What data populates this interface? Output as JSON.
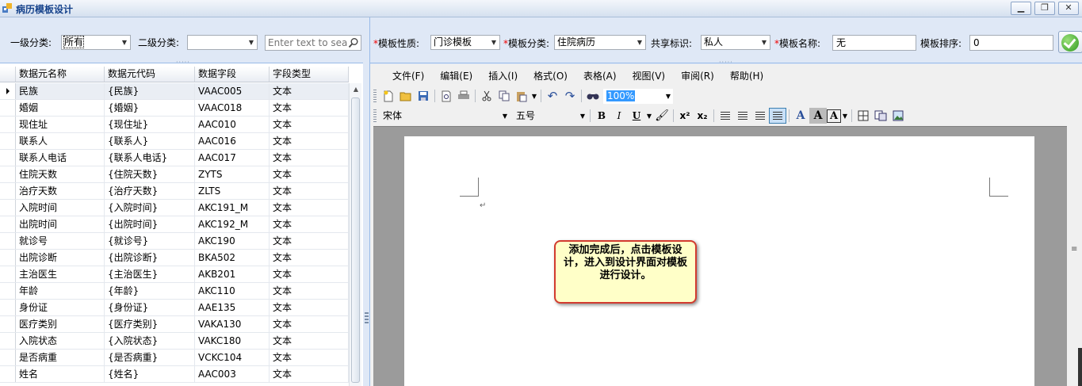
{
  "window": {
    "title": "病历模板设计",
    "min": "▁",
    "restore": "❐",
    "close": "✕"
  },
  "filters": {
    "level1_label": "一级分类:",
    "level1_value": "所有",
    "level2_label": "二级分类:",
    "level2_value": "",
    "search_placeholder": "Enter text to sear"
  },
  "grid": {
    "columns": [
      "数据元名称",
      "数据元代码",
      "数据字段",
      "字段类型"
    ],
    "rows": [
      [
        "民族",
        "{民族}",
        "VAAC005",
        "文本"
      ],
      [
        "婚姻",
        "{婚姻}",
        "VAAC018",
        "文本"
      ],
      [
        "现住址",
        "{现住址}",
        "AAC010",
        "文本"
      ],
      [
        "联系人",
        "{联系人}",
        "AAC016",
        "文本"
      ],
      [
        "联系人电话",
        "{联系人电话}",
        "AAC017",
        "文本"
      ],
      [
        "住院天数",
        "{住院天数}",
        "ZYTS",
        "文本"
      ],
      [
        "治疗天数",
        "{治疗天数}",
        "ZLTS",
        "文本"
      ],
      [
        "入院时间",
        "{入院时间}",
        "AKC191_M",
        "文本"
      ],
      [
        "出院时间",
        "{出院时间}",
        "AKC192_M",
        "文本"
      ],
      [
        "就诊号",
        "{就诊号}",
        "AKC190",
        "文本"
      ],
      [
        "出院诊断",
        "{出院诊断}",
        "BKA502",
        "文本"
      ],
      [
        "主治医生",
        "{主治医生}",
        "AKB201",
        "文本"
      ],
      [
        "年龄",
        "{年龄}",
        "AKC110",
        "文本"
      ],
      [
        "身份证",
        "{身份证}",
        "AAE135",
        "文本"
      ],
      [
        "医疗类别",
        "{医疗类别}",
        "VAKA130",
        "文本"
      ],
      [
        "入院状态",
        "{入院状态}",
        "VAKC180",
        "文本"
      ],
      [
        "是否病重",
        "{是否病重}",
        "VCKC104",
        "文本"
      ],
      [
        "姓名",
        "{姓名}",
        "AAC003",
        "文本"
      ]
    ]
  },
  "template": {
    "nature_label": "模板性质:",
    "nature_value": "门诊模板",
    "category_label": "模板分类:",
    "category_value": "住院病历",
    "share_label": "共享标识:",
    "share_value": "私人",
    "name_label": "模板名称:",
    "name_value": "无",
    "order_label": "模板排序:",
    "order_value": "0",
    "required_mark": "*"
  },
  "menu": [
    "文件(F)",
    "编辑(E)",
    "插入(I)",
    "格式(O)",
    "表格(A)",
    "视图(V)",
    "审阅(R)",
    "帮助(H)"
  ],
  "toolbar": {
    "zoom": "100%",
    "font": "宋体",
    "size": "五号"
  },
  "document": {
    "paragraph_mark": "↵"
  },
  "callout": {
    "text": "添加完成后，点击模板设计，进入到设计界面对模板进行设计。"
  }
}
